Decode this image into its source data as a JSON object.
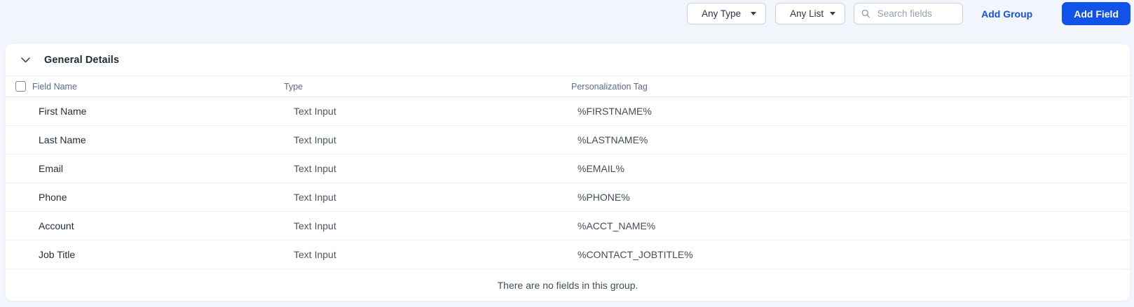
{
  "toolbar": {
    "type_filter_value": "Any Type",
    "list_filter_value": "Any List",
    "search_placeholder": "Search fields",
    "add_group_label": "Add Group",
    "add_field_label": "Add Field"
  },
  "group": {
    "title": "General Details",
    "empty_message": "There are no fields in this group."
  },
  "table": {
    "headers": {
      "name": "Field Name",
      "type": "Type",
      "tag": "Personalization Tag"
    },
    "rows": [
      {
        "name": "First Name",
        "type": "Text Input",
        "tag": "%FIRSTNAME%"
      },
      {
        "name": "Last Name",
        "type": "Text Input",
        "tag": "%LASTNAME%"
      },
      {
        "name": "Email",
        "type": "Text Input",
        "tag": "%EMAIL%"
      },
      {
        "name": "Phone",
        "type": "Text Input",
        "tag": "%PHONE%"
      },
      {
        "name": "Account",
        "type": "Text Input",
        "tag": "%ACCT_NAME%"
      },
      {
        "name": "Job Title",
        "type": "Text Input",
        "tag": "%CONTACT_JOBTITLE%"
      }
    ]
  },
  "colors": {
    "accent_blue": "#1153e8",
    "page_background": "#f2f5fb",
    "panel_background": "#ffffff"
  }
}
